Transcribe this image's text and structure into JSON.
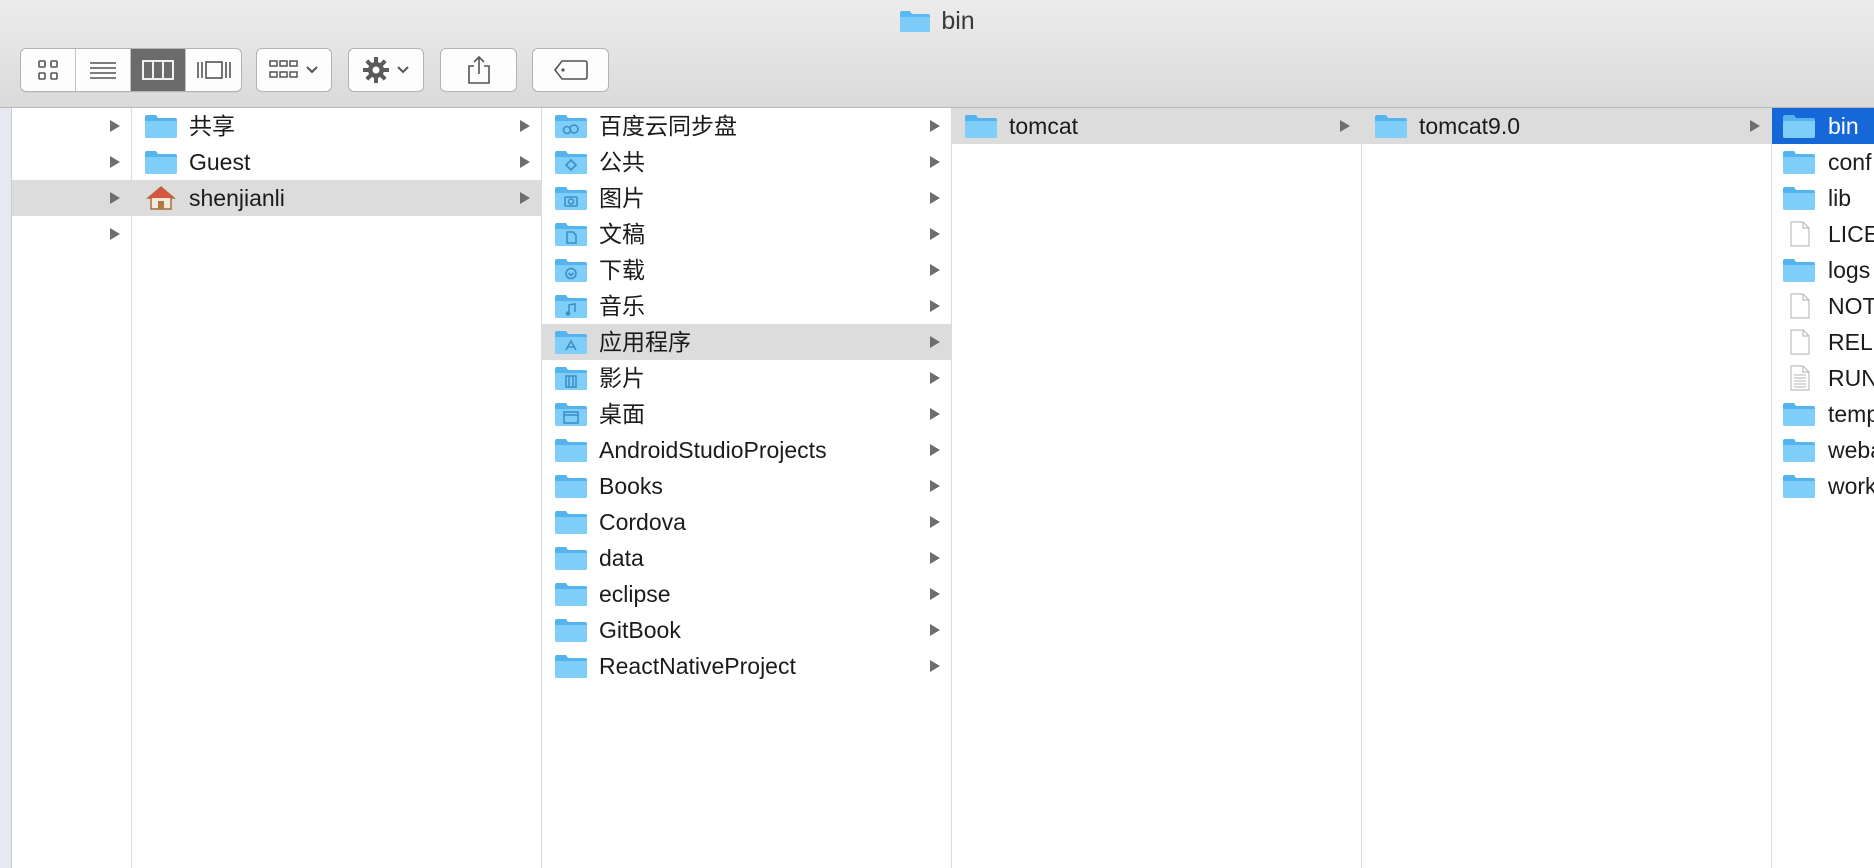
{
  "window": {
    "title": "bin"
  },
  "toolbar": {
    "view_buttons": [
      {
        "name": "icon-view",
        "icon": "grid-icon"
      },
      {
        "name": "list-view",
        "icon": "list-icon"
      },
      {
        "name": "column-view",
        "icon": "columns-icon",
        "active": true
      },
      {
        "name": "gallery-view",
        "icon": "coverflow-icon"
      }
    ],
    "arrange_icon": "arrange-icon",
    "action_icon": "gear-icon",
    "share_icon": "share-icon",
    "tag_icon": "tag-icon"
  },
  "columns": [
    {
      "rows": [
        {
          "label": "",
          "arrow": true
        },
        {
          "label": "",
          "arrow": true
        },
        {
          "label": "",
          "arrow": true,
          "selected": true
        },
        {
          "label": "",
          "arrow": true
        }
      ]
    },
    {
      "rows": [
        {
          "label": "共享",
          "icon": "folder-icon",
          "arrow": true
        },
        {
          "label": "Guest",
          "icon": "folder-icon",
          "arrow": true
        },
        {
          "label": "shenjianli",
          "icon": "home-icon",
          "arrow": true,
          "selected": true
        }
      ]
    },
    {
      "rows": [
        {
          "label": "百度云同步盘",
          "icon": "cloud-folder-icon",
          "arrow": true
        },
        {
          "label": "公共",
          "icon": "public-folder-icon",
          "arrow": true
        },
        {
          "label": "图片",
          "icon": "pictures-folder-icon",
          "arrow": true
        },
        {
          "label": "文稿",
          "icon": "documents-folder-icon",
          "arrow": true
        },
        {
          "label": "下载",
          "icon": "downloads-folder-icon",
          "arrow": true
        },
        {
          "label": "音乐",
          "icon": "music-folder-icon",
          "arrow": true
        },
        {
          "label": "应用程序",
          "icon": "applications-folder-icon",
          "arrow": true,
          "selected": true
        },
        {
          "label": "影片",
          "icon": "movies-folder-icon",
          "arrow": true
        },
        {
          "label": "桌面",
          "icon": "desktop-folder-icon",
          "arrow": true
        },
        {
          "label": "AndroidStudioProjects",
          "icon": "folder-icon",
          "arrow": true
        },
        {
          "label": "Books",
          "icon": "folder-icon",
          "arrow": true
        },
        {
          "label": "Cordova",
          "icon": "folder-icon",
          "arrow": true
        },
        {
          "label": "data",
          "icon": "folder-icon",
          "arrow": true
        },
        {
          "label": "eclipse",
          "icon": "folder-icon",
          "arrow": true
        },
        {
          "label": "GitBook",
          "icon": "folder-icon",
          "arrow": true
        },
        {
          "label": "ReactNativeProject",
          "icon": "folder-icon",
          "arrow": true
        }
      ]
    },
    {
      "rows": [
        {
          "label": "tomcat",
          "icon": "folder-icon",
          "arrow": true,
          "selected": true
        }
      ]
    },
    {
      "rows": [
        {
          "label": "tomcat9.0",
          "icon": "folder-icon",
          "arrow": true,
          "selected": true
        }
      ]
    },
    {
      "rows": [
        {
          "label": "bin",
          "icon": "folder-icon",
          "active": true
        },
        {
          "label": "conf",
          "icon": "folder-icon"
        },
        {
          "label": "lib",
          "icon": "folder-icon"
        },
        {
          "label": "LICENSE",
          "icon": "file-icon"
        },
        {
          "label": "logs",
          "icon": "folder-icon"
        },
        {
          "label": "NOTICE",
          "icon": "file-icon"
        },
        {
          "label": "RELEASE-NOTES",
          "icon": "file-icon"
        },
        {
          "label": "RUNNING.txt",
          "icon": "text-file-icon"
        },
        {
          "label": "temp",
          "icon": "folder-icon"
        },
        {
          "label": "webapps",
          "icon": "folder-icon"
        },
        {
          "label": "work",
          "icon": "folder-icon"
        }
      ]
    }
  ],
  "colors": {
    "folder_blue": "#6cc3f7",
    "selection_gray": "#dcdcdc",
    "active_blue": "#1668d9"
  }
}
